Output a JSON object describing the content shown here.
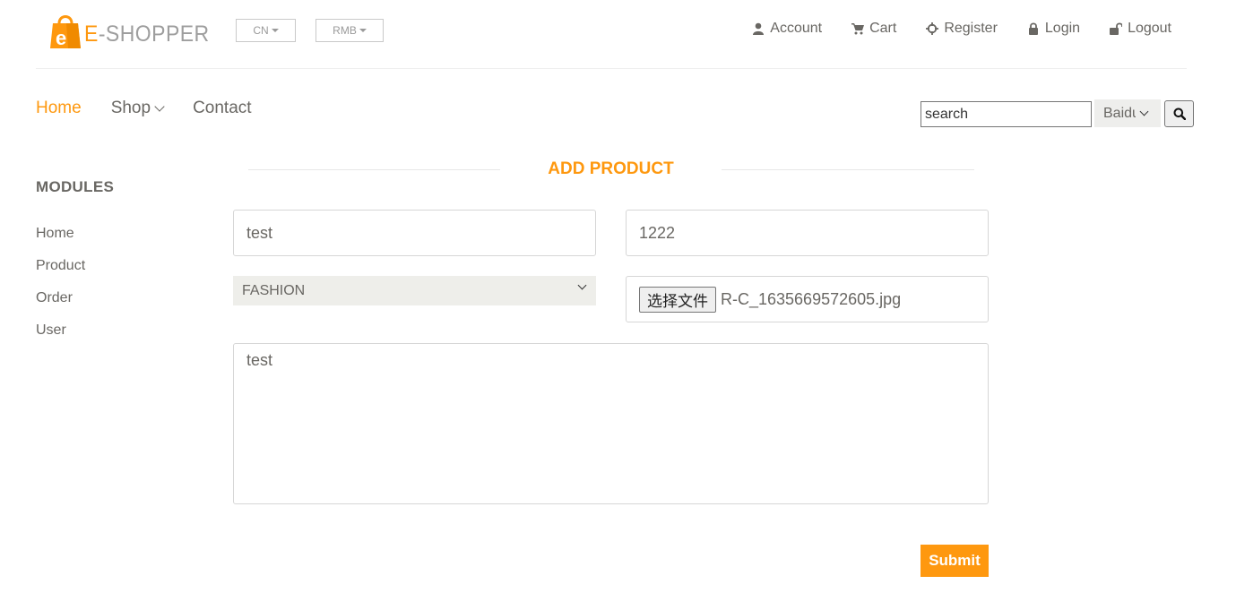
{
  "logo": {
    "e_letter": "E",
    "text": "-SHOPPER",
    "bag_letter": "e"
  },
  "header": {
    "language": "CN",
    "currency": "RMB",
    "links": [
      {
        "label": "Account",
        "icon": "user-icon"
      },
      {
        "label": "Cart",
        "icon": "cart-icon"
      },
      {
        "label": "Register",
        "icon": "crosshairs-icon"
      },
      {
        "label": "Login",
        "icon": "lock-icon"
      },
      {
        "label": "Logout",
        "icon": "unlock-icon"
      }
    ]
  },
  "nav": {
    "home": "Home",
    "shop": "Shop",
    "contact": "Contact"
  },
  "search": {
    "value": "search",
    "engine": "Baidu"
  },
  "sidebar": {
    "title": "MODULES",
    "items": [
      {
        "label": "Home"
      },
      {
        "label": "Product"
      },
      {
        "label": "Order"
      },
      {
        "label": "User"
      }
    ]
  },
  "form": {
    "title": "ADD PRODUCT",
    "name_value": "test",
    "price_value": "1222",
    "category_value": "FASHION",
    "file_button_label": "选择文件",
    "file_name": "R-C_1635669572605.jpg",
    "description_value": "test",
    "submit_label": "Submit"
  },
  "colors": {
    "accent": "#FE980F",
    "text": "#696763"
  }
}
